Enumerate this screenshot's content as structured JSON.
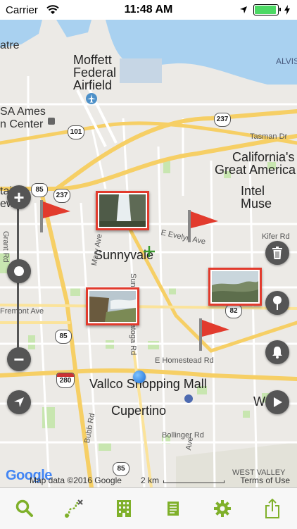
{
  "status_bar": {
    "carrier": "Carrier",
    "time": "11:48 AM"
  },
  "map": {
    "places": {
      "atre": "atre",
      "moffett": "Moffett",
      "federal": "Federal",
      "airfield": "Airfield",
      "ames": "SA Ames",
      "center": "n Center",
      "tasman": "Tasman Dr",
      "californias": "California's",
      "great_america": "Great America",
      "intel": "Intel Muse",
      "kifer": "Kifer Rd",
      "alviso": "ALVIS",
      "sunnyvale": "Sunnyvale",
      "e_evelyn": "E Evelyn Ave",
      "fremont": "Fremont Ave",
      "e_homestead": "E Homestead Rd",
      "vallco": "Vallco Shopping Mall",
      "cupertino": "Cupertino",
      "bollinger": "Bollinger Rd",
      "west_valley": "WEST VALLEY",
      "westfield": "Westfi",
      "tain": "tain",
      "ew": "ew",
      "grant_rd": "Grant Rd",
      "mary_ave": "Mary Ave",
      "saratoga": "Sunnyvale Saratoga Rd",
      "bubb": "Bubb Rd",
      "ave": "Ave"
    },
    "shields": {
      "h101": "101",
      "h237a": "237",
      "h237b": "237",
      "h85a": "85",
      "h85b": "85",
      "h85c": "85",
      "h85d": "85",
      "h82": "82",
      "i280": "280"
    },
    "attribution": "Map data ©2016 Google",
    "scale": "2 km",
    "terms": "Terms of Use",
    "google_logo": "Google"
  },
  "map_controls": {
    "zoom_in": "+",
    "zoom_out": "−"
  },
  "icons": {
    "wifi": "wifi-icon",
    "location_arrow": "location-arrow-icon",
    "charging": "charging-icon",
    "trash": "trash-icon",
    "pin": "pin-icon",
    "bell": "bell-icon",
    "play": "play-icon"
  },
  "tab_bar": {
    "items": [
      {
        "icon": "search-icon"
      },
      {
        "icon": "route-icon"
      },
      {
        "icon": "building-icon"
      },
      {
        "icon": "book-icon"
      },
      {
        "icon": "gear-icon"
      },
      {
        "icon": "share-icon"
      }
    ]
  },
  "colors": {
    "accent": "#7fb02a",
    "flag": "#e23b2d",
    "water": "#a9d1f0"
  }
}
